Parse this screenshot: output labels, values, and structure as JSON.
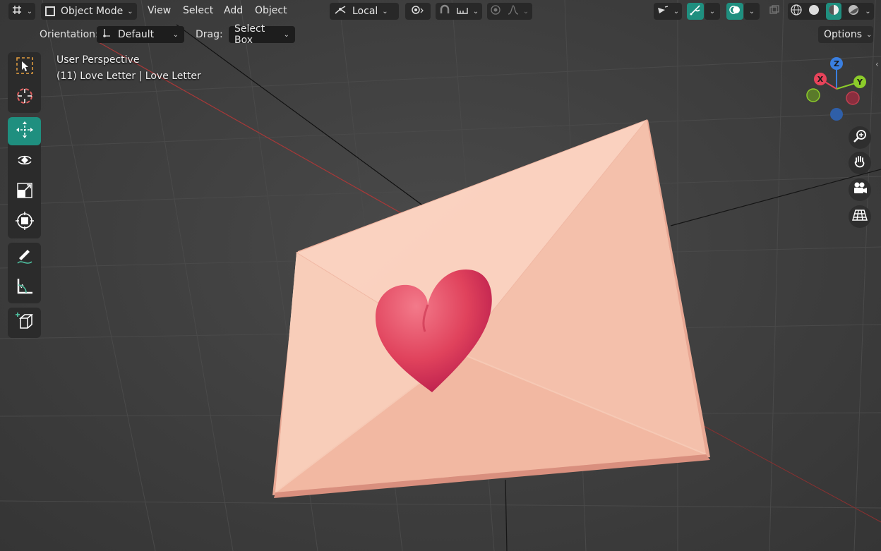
{
  "header": {
    "mode_label": "Object Mode",
    "menus": {
      "view": "View",
      "select": "Select",
      "add": "Add",
      "object": "Object"
    },
    "transform_space": "Local",
    "options_label": "Options"
  },
  "tool_options": {
    "orientation_label": "Orientation:",
    "orientation_value": "Default",
    "drag_label": "Drag:",
    "drag_value": "Select Box"
  },
  "viewport": {
    "view_name": "User Perspective",
    "object_info": "(11) Love Letter | Love Letter"
  },
  "gizmo": {
    "x": "X",
    "y": "Y",
    "z": "Z"
  },
  "colors": {
    "accent": "#1f8f7f",
    "envelope": "#f5c4b0",
    "heart": "#e0405a",
    "axis_x": "#e8435a",
    "axis_y": "#8ccc2a",
    "axis_z": "#3a7fe0"
  },
  "icons": {
    "editor_type": "editor-type-icon",
    "select": "select-box-icon",
    "cursor": "cursor-icon",
    "move": "move-icon",
    "rotate": "rotate-icon",
    "scale": "scale-icon",
    "transform": "transform-icon",
    "annotate": "annotate-icon",
    "measure": "measure-icon",
    "add_cube": "add-cube-icon",
    "zoom": "zoom-icon",
    "pan": "hand-icon",
    "camera": "camera-icon",
    "grid": "ortho-grid-icon"
  }
}
